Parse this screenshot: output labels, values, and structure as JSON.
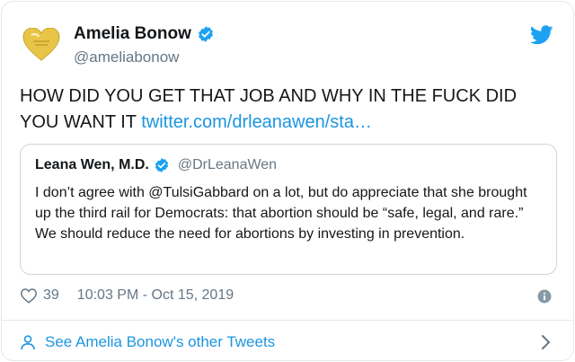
{
  "author": {
    "name": "Amelia Bonow",
    "handle": "@ameliabonow",
    "avatar": "gold-heart-avatar",
    "verified_icon": "verified-badge-icon"
  },
  "tweet": {
    "text": "HOW DID YOU GET THAT JOB AND WHY IN THE FUCK DID YOU WANT IT ",
    "link_text": "twitter.com/drleanawen/sta…"
  },
  "quoted_tweet": {
    "name": "Leana Wen, M.D.",
    "handle": "@DrLeanaWen",
    "text": "I don’t agree with @TulsiGabbard on a lot, but do appreciate that she brought up the third rail for Democrats: that abortion should be “safe, legal, and rare.” We should reduce the need for abortions by investing in prevention."
  },
  "meta": {
    "likes": "39",
    "timestamp": "10:03 PM - Oct 15, 2019"
  },
  "footer": {
    "see_more": "See Amelia Bonow's other Tweets"
  },
  "colors": {
    "link_blue": "#1b95e0",
    "muted_gray": "#657786",
    "verified_blue": "#1da1f2",
    "avatar_gold": "#e8c547"
  }
}
